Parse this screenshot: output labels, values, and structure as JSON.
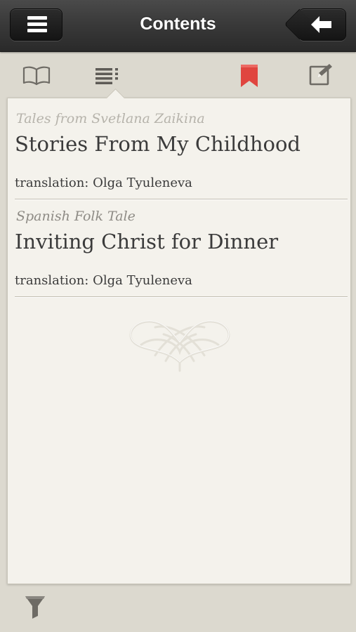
{
  "header": {
    "title": "Contents"
  },
  "toolbar": {
    "icons": [
      "book-icon",
      "list-icon",
      "bookmark-icon",
      "edit-note-icon"
    ],
    "bookmark_color": "#e0453f"
  },
  "entries": [
    {
      "author": "Tales from Svetlana Zaikina",
      "author_color": "#b6b3ab",
      "title": "Stories From My Childhood",
      "translator": "translation: Olga Tyuleneva"
    },
    {
      "author": "Spanish Folk Tale",
      "author_color": "#8e8b85",
      "title": "Inviting Christ for Dinner",
      "translator": "translation: Olga Tyuleneva"
    }
  ],
  "bottom": {
    "icons": [
      "filter-icon"
    ]
  }
}
